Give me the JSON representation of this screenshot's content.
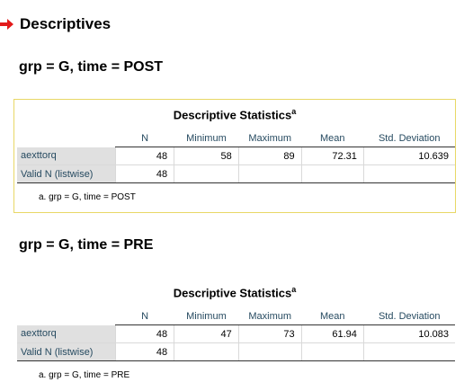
{
  "header": {
    "title": "Descriptives",
    "arrow_icon": "red-arrow-icon",
    "arrow_color": "#e21a1a"
  },
  "sections": [
    {
      "heading": "grp = G, time = POST",
      "table_title": "Descriptive Statistics",
      "table_title_sup": "a",
      "columns": [
        "N",
        "Minimum",
        "Maximum",
        "Mean",
        "Std. Deviation"
      ],
      "rows": [
        {
          "label": "aexttorq",
          "values": [
            "48",
            "58",
            "89",
            "72.31",
            "10.639"
          ]
        },
        {
          "label": "Valid N (listwise)",
          "values": [
            "48",
            "",
            "",
            "",
            ""
          ]
        }
      ],
      "footnote": "a. grp = G, time = POST"
    },
    {
      "heading": "grp = G, time = PRE",
      "table_title": "Descriptive Statistics",
      "table_title_sup": "a",
      "columns": [
        "N",
        "Minimum",
        "Maximum",
        "Mean",
        "Std. Deviation"
      ],
      "rows": [
        {
          "label": "aexttorq",
          "values": [
            "48",
            "47",
            "73",
            "61.94",
            "10.083"
          ]
        },
        {
          "label": "Valid N (listwise)",
          "values": [
            "48",
            "",
            "",
            "",
            ""
          ]
        }
      ],
      "footnote": "a. grp = G, time = PRE"
    }
  ]
}
